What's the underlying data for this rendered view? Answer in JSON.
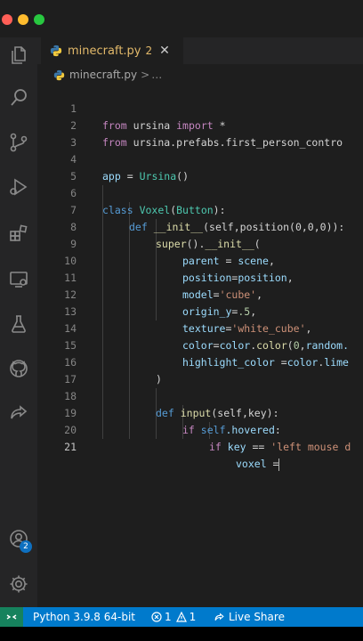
{
  "window": {
    "traffic_lights": [
      "#ff5f57",
      "#febc2e",
      "#28c840"
    ]
  },
  "activity_bar": {
    "items": [
      {
        "icon": "explorer-icon"
      },
      {
        "icon": "search-icon"
      },
      {
        "icon": "source-control-icon"
      },
      {
        "icon": "run-debug-icon"
      },
      {
        "icon": "extensions-icon"
      },
      {
        "icon": "remote-explorer-icon"
      },
      {
        "icon": "testing-icon"
      },
      {
        "icon": "github-icon"
      },
      {
        "icon": "live-share-icon"
      }
    ],
    "accounts_badge": "2",
    "bottom": [
      {
        "icon": "accounts-icon"
      },
      {
        "icon": "manage-gear-icon"
      }
    ]
  },
  "tabs": [
    {
      "label": "minecraft.py",
      "problems": "2",
      "close": "✕",
      "icon": "python-file-icon"
    }
  ],
  "breadcrumb": {
    "file": "minecraft.py",
    "separator": ">",
    "more": "…"
  },
  "editor": {
    "active_line": 21,
    "lines": [
      {
        "n": "1"
      },
      {
        "n": "2"
      },
      {
        "n": "3"
      },
      {
        "n": "4"
      },
      {
        "n": "5"
      },
      {
        "n": "6"
      },
      {
        "n": "7"
      },
      {
        "n": "8"
      },
      {
        "n": "9"
      },
      {
        "n": "10"
      },
      {
        "n": "11"
      },
      {
        "n": "12"
      },
      {
        "n": "13"
      },
      {
        "n": "14"
      },
      {
        "n": "15"
      },
      {
        "n": "16"
      },
      {
        "n": "17"
      },
      {
        "n": "18"
      },
      {
        "n": "19"
      },
      {
        "n": "20"
      },
      {
        "n": "21"
      }
    ],
    "code": {
      "l1": {
        "from": "from",
        "module": "ursina",
        "import": "import",
        "star": "*"
      },
      "l2": {
        "from": "from",
        "module": "ursina.prefabs.first_person_contro"
      },
      "l4": {
        "var": "app",
        "eq": "=",
        "call": "Ursina",
        "paren": "()"
      },
      "l6": {
        "class": "class",
        "name": "Voxel",
        "open": "(",
        "base": "Button",
        "close": "):"
      },
      "l7": {
        "def": "def",
        "name": "__init__",
        "args": "(self,position(0,0,0)):"
      },
      "l8": {
        "super": "super",
        "mid": "().",
        "init": "__init__",
        "open": "("
      },
      "l9": {
        "key": "parent",
        "eq": " = ",
        "val": "scene",
        "comma": ","
      },
      "l10": {
        "key": "position",
        "eq": "=",
        "val": "position",
        "comma": ","
      },
      "l11": {
        "key": "model",
        "eq": "=",
        "str": "'cube'",
        "comma": ","
      },
      "l12": {
        "key": "origin_y",
        "eq": "=",
        "num": ".5",
        "comma": ","
      },
      "l13": {
        "key": "texture",
        "eq": "=",
        "str": "'white_cube'",
        "comma": ","
      },
      "l14": {
        "key": "color",
        "eq": "=",
        "obj": "color",
        "dot": ".",
        "fn": "color",
        "open": "(",
        "num": "0",
        "comma": ",",
        "rest": "random."
      },
      "l15": {
        "key": "highlight_color",
        "eq": " =",
        "obj": "color",
        "dot": ".",
        "rest": "lime"
      },
      "l16": {
        "close": ")"
      },
      "l18": {
        "def": "def",
        "name": "input",
        "args": "(self,key):"
      },
      "l19": {
        "if": "if",
        "self": "self",
        "attr": ".hovered",
        "colon": ":"
      },
      "l20": {
        "if": "if",
        "key": "key",
        "op": " == ",
        "str": "'left mouse d"
      },
      "l21": {
        "var": "voxel",
        "eq": " ="
      }
    }
  },
  "status_bar": {
    "remote_icon": "remote-indicator-icon",
    "interpreter": "Python 3.9.8 64-bit",
    "errors": "1",
    "warnings": "1",
    "live_share": "Live Share",
    "colors": {
      "background": "#007acc",
      "remote": "#16825d"
    }
  }
}
